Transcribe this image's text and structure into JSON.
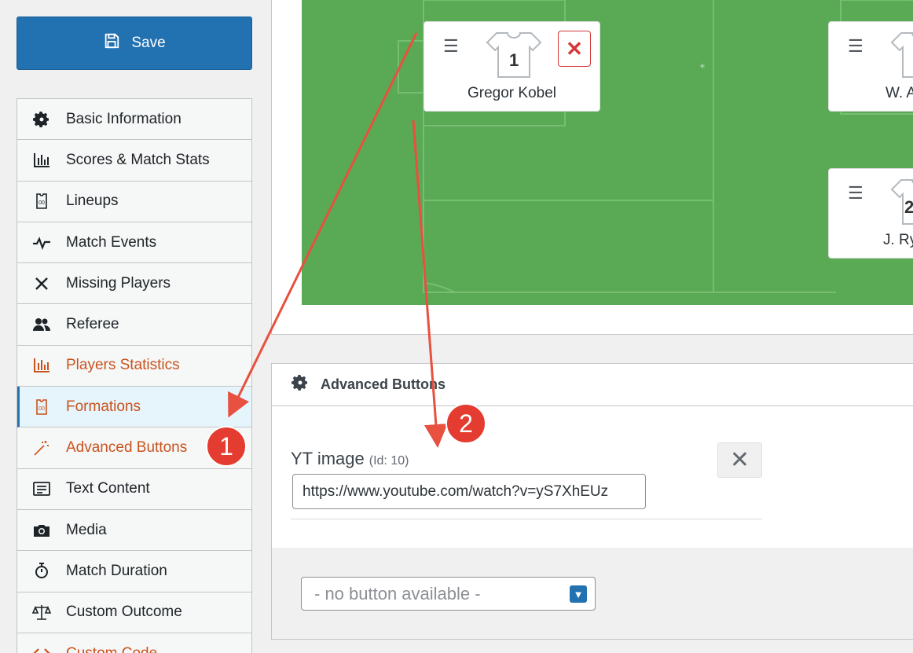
{
  "save_button": {
    "label": "Save",
    "icon": "floppy-disk-icon"
  },
  "menu": {
    "items": [
      {
        "label": "Basic Information",
        "icon": "gear-icon",
        "state": "normal"
      },
      {
        "label": "Scores & Match Stats",
        "icon": "bar-chart-icon",
        "state": "normal"
      },
      {
        "label": "Lineups",
        "icon": "jersey-icon",
        "state": "normal"
      },
      {
        "label": "Match Events",
        "icon": "pulse-icon",
        "state": "normal"
      },
      {
        "label": "Missing Players",
        "icon": "x-icon",
        "state": "normal"
      },
      {
        "label": "Referee",
        "icon": "users-icon",
        "state": "normal"
      },
      {
        "label": "Players Statistics",
        "icon": "bar-chart-icon",
        "state": "orange"
      },
      {
        "label": "Formations",
        "icon": "jersey-icon",
        "state": "active"
      },
      {
        "label": "Advanced Buttons",
        "icon": "magic-wand-icon",
        "state": "orange"
      },
      {
        "label": "Text Content",
        "icon": "text-icon",
        "state": "normal"
      },
      {
        "label": "Media",
        "icon": "camera-icon",
        "state": "normal"
      },
      {
        "label": "Match Duration",
        "icon": "stopwatch-icon",
        "state": "normal"
      },
      {
        "label": "Custom Outcome",
        "icon": "scales-icon",
        "state": "normal"
      },
      {
        "label": "Custom Code",
        "icon": "code-icon",
        "state": "orange"
      }
    ]
  },
  "pitch": {
    "players": [
      {
        "number": "1",
        "name": "Gregor Kobel"
      },
      {
        "number": "",
        "name": "W. A"
      },
      {
        "number": "2",
        "name": "J. Ry"
      }
    ]
  },
  "advanced": {
    "title": "Advanced Buttons",
    "field_label": "YT image",
    "field_id": "(Id: 10)",
    "field_value": "https://www.youtube.com/watch?v=yS7XhEUz",
    "select_placeholder": "- no button available -"
  },
  "annotations": {
    "badge1": "1",
    "badge2": "2"
  },
  "colors": {
    "accent": "#2271b1",
    "pitch": "#5aa955",
    "orange": "#c9531d",
    "badge": "#e43c30"
  }
}
